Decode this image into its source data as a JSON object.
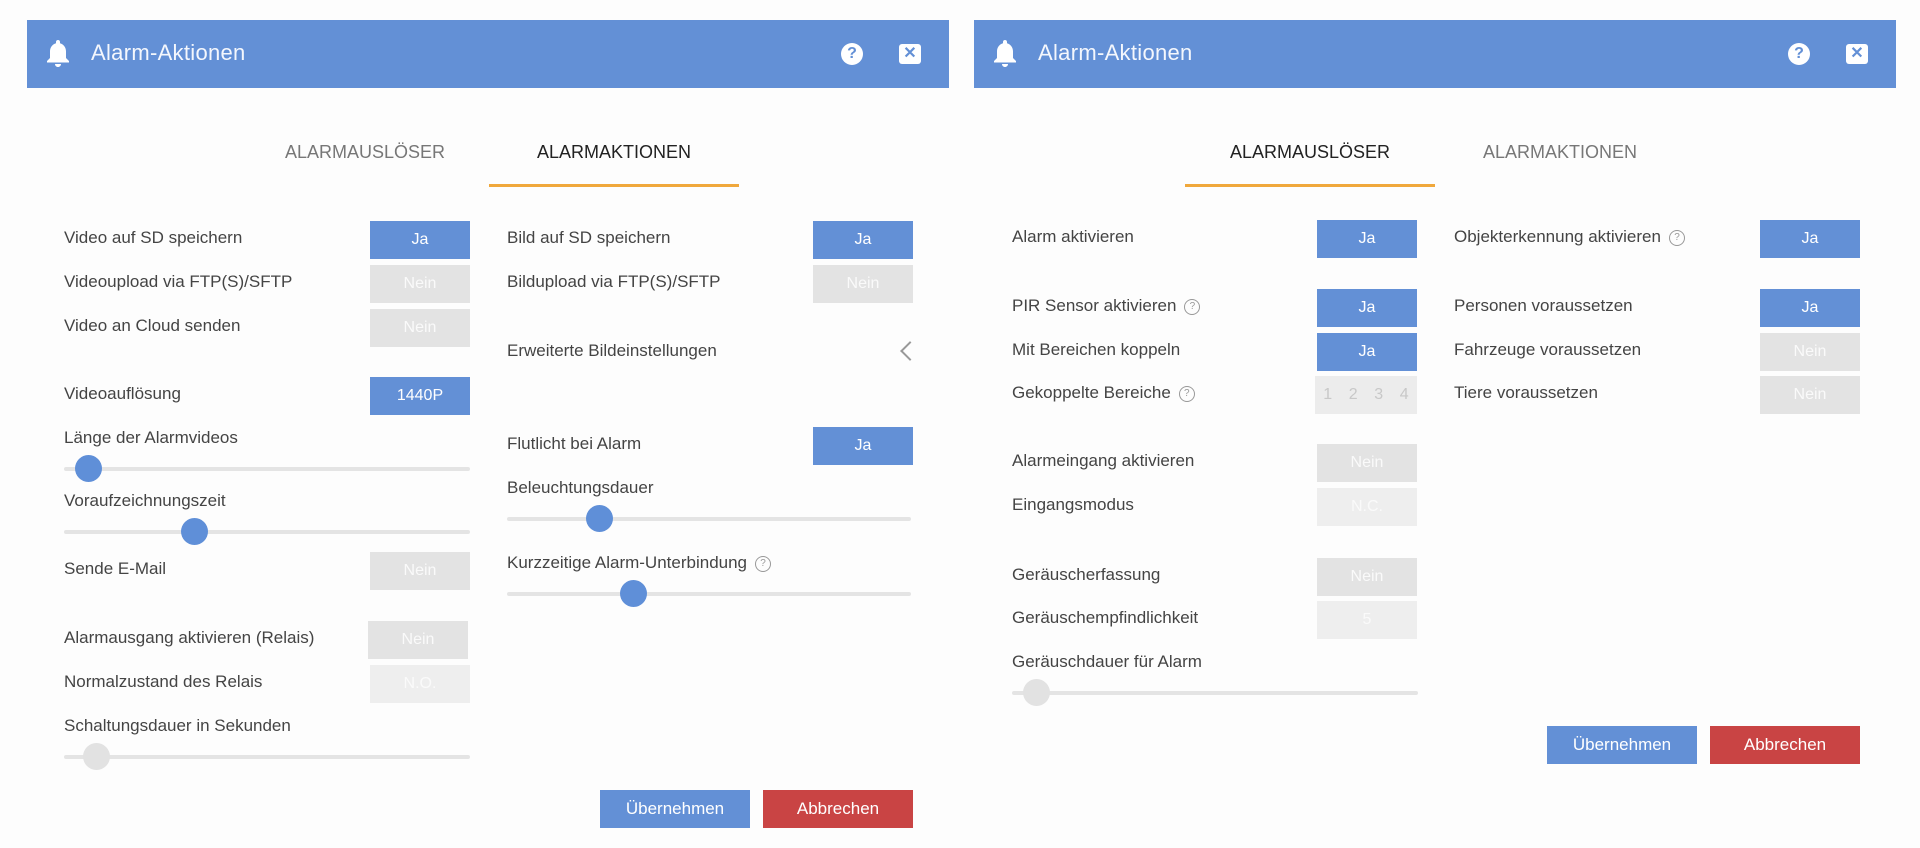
{
  "left": {
    "header": {
      "title": "Alarm-Aktionen"
    },
    "tabs": {
      "trigger": "ALARMAUSLÖSER",
      "actions": "ALARMAKTIONEN"
    },
    "col1": {
      "video_sd": {
        "label": "Video auf SD speichern",
        "value": "Ja"
      },
      "video_ftp": {
        "label": "Videoupload via FTP(S)/SFTP",
        "value": "Nein"
      },
      "video_cloud": {
        "label": "Video an Cloud senden",
        "value": "Nein"
      },
      "resolution": {
        "label": "Videoauflösung",
        "value": "1440P"
      },
      "video_length": {
        "label": "Länge der Alarmvideos",
        "level": 0.03
      },
      "prerecord": {
        "label": "Voraufzeichnungszeit",
        "level": 0.31
      },
      "email": {
        "label": "Sende E-Mail",
        "value": "Nein"
      },
      "relay": {
        "label": "Alarmausgang aktivieren (Relais)",
        "value": "Nein"
      },
      "relay_state": {
        "label": "Normalzustand des Relais",
        "value": "N.O."
      },
      "switch_duration": {
        "label": "Schaltungsdauer in Sekunden",
        "level": 0.05
      }
    },
    "col2": {
      "image_sd": {
        "label": "Bild auf SD speichern",
        "value": "Ja"
      },
      "image_ftp": {
        "label": "Bildupload via FTP(S)/SFTP",
        "value": "Nein"
      },
      "advanced_image": {
        "label": "Erweiterte Bildeinstellungen"
      },
      "floodlight": {
        "label": "Flutlicht bei Alarm",
        "value": "Ja"
      },
      "light_duration": {
        "label": "Beleuchtungsdauer",
        "level": 0.21
      },
      "suppression": {
        "label": "Kurzzeitige Alarm-Unterbindung",
        "level": 0.3
      }
    },
    "actions": {
      "apply": "Übernehmen",
      "cancel": "Abbrechen"
    }
  },
  "right": {
    "header": {
      "title": "Alarm-Aktionen"
    },
    "tabs": {
      "trigger": "ALARMAUSLÖSER",
      "actions": "ALARMAKTIONEN"
    },
    "col1": {
      "alarm_enable": {
        "label": "Alarm aktivieren",
        "value": "Ja"
      },
      "pir": {
        "label": "PIR Sensor aktivieren",
        "value": "Ja"
      },
      "couple_areas": {
        "label": "Mit Bereichen koppeln",
        "value": "Ja"
      },
      "coupled_areas": {
        "label": "Gekoppelte Bereiche",
        "values": [
          "1",
          "2",
          "3",
          "4"
        ]
      },
      "alarm_input": {
        "label": "Alarmeingang aktivieren",
        "value": "Nein"
      },
      "input_mode": {
        "label": "Eingangsmodus",
        "value": "N.C."
      },
      "noise": {
        "label": "Geräuscherfassung",
        "value": "Nein"
      },
      "noise_sensitivity": {
        "label": "Geräuschempfindlichkeit",
        "value": "5"
      },
      "noise_duration": {
        "label": "Geräuschdauer für Alarm",
        "level": 0.03
      }
    },
    "col2": {
      "object_detection": {
        "label": "Objekterkennung aktivieren",
        "value": "Ja"
      },
      "persons": {
        "label": "Personen voraussetzen",
        "value": "Ja"
      },
      "vehicles": {
        "label": "Fahrzeuge voraussetzen",
        "value": "Nein"
      },
      "animals": {
        "label": "Tiere voraussetzen",
        "value": "Nein"
      }
    },
    "actions": {
      "apply": "Übernehmen",
      "cancel": "Abbrechen"
    }
  },
  "colors": {
    "accent": "#6390d6",
    "tab_underline": "#f0a83c",
    "cancel": "#c94444"
  }
}
